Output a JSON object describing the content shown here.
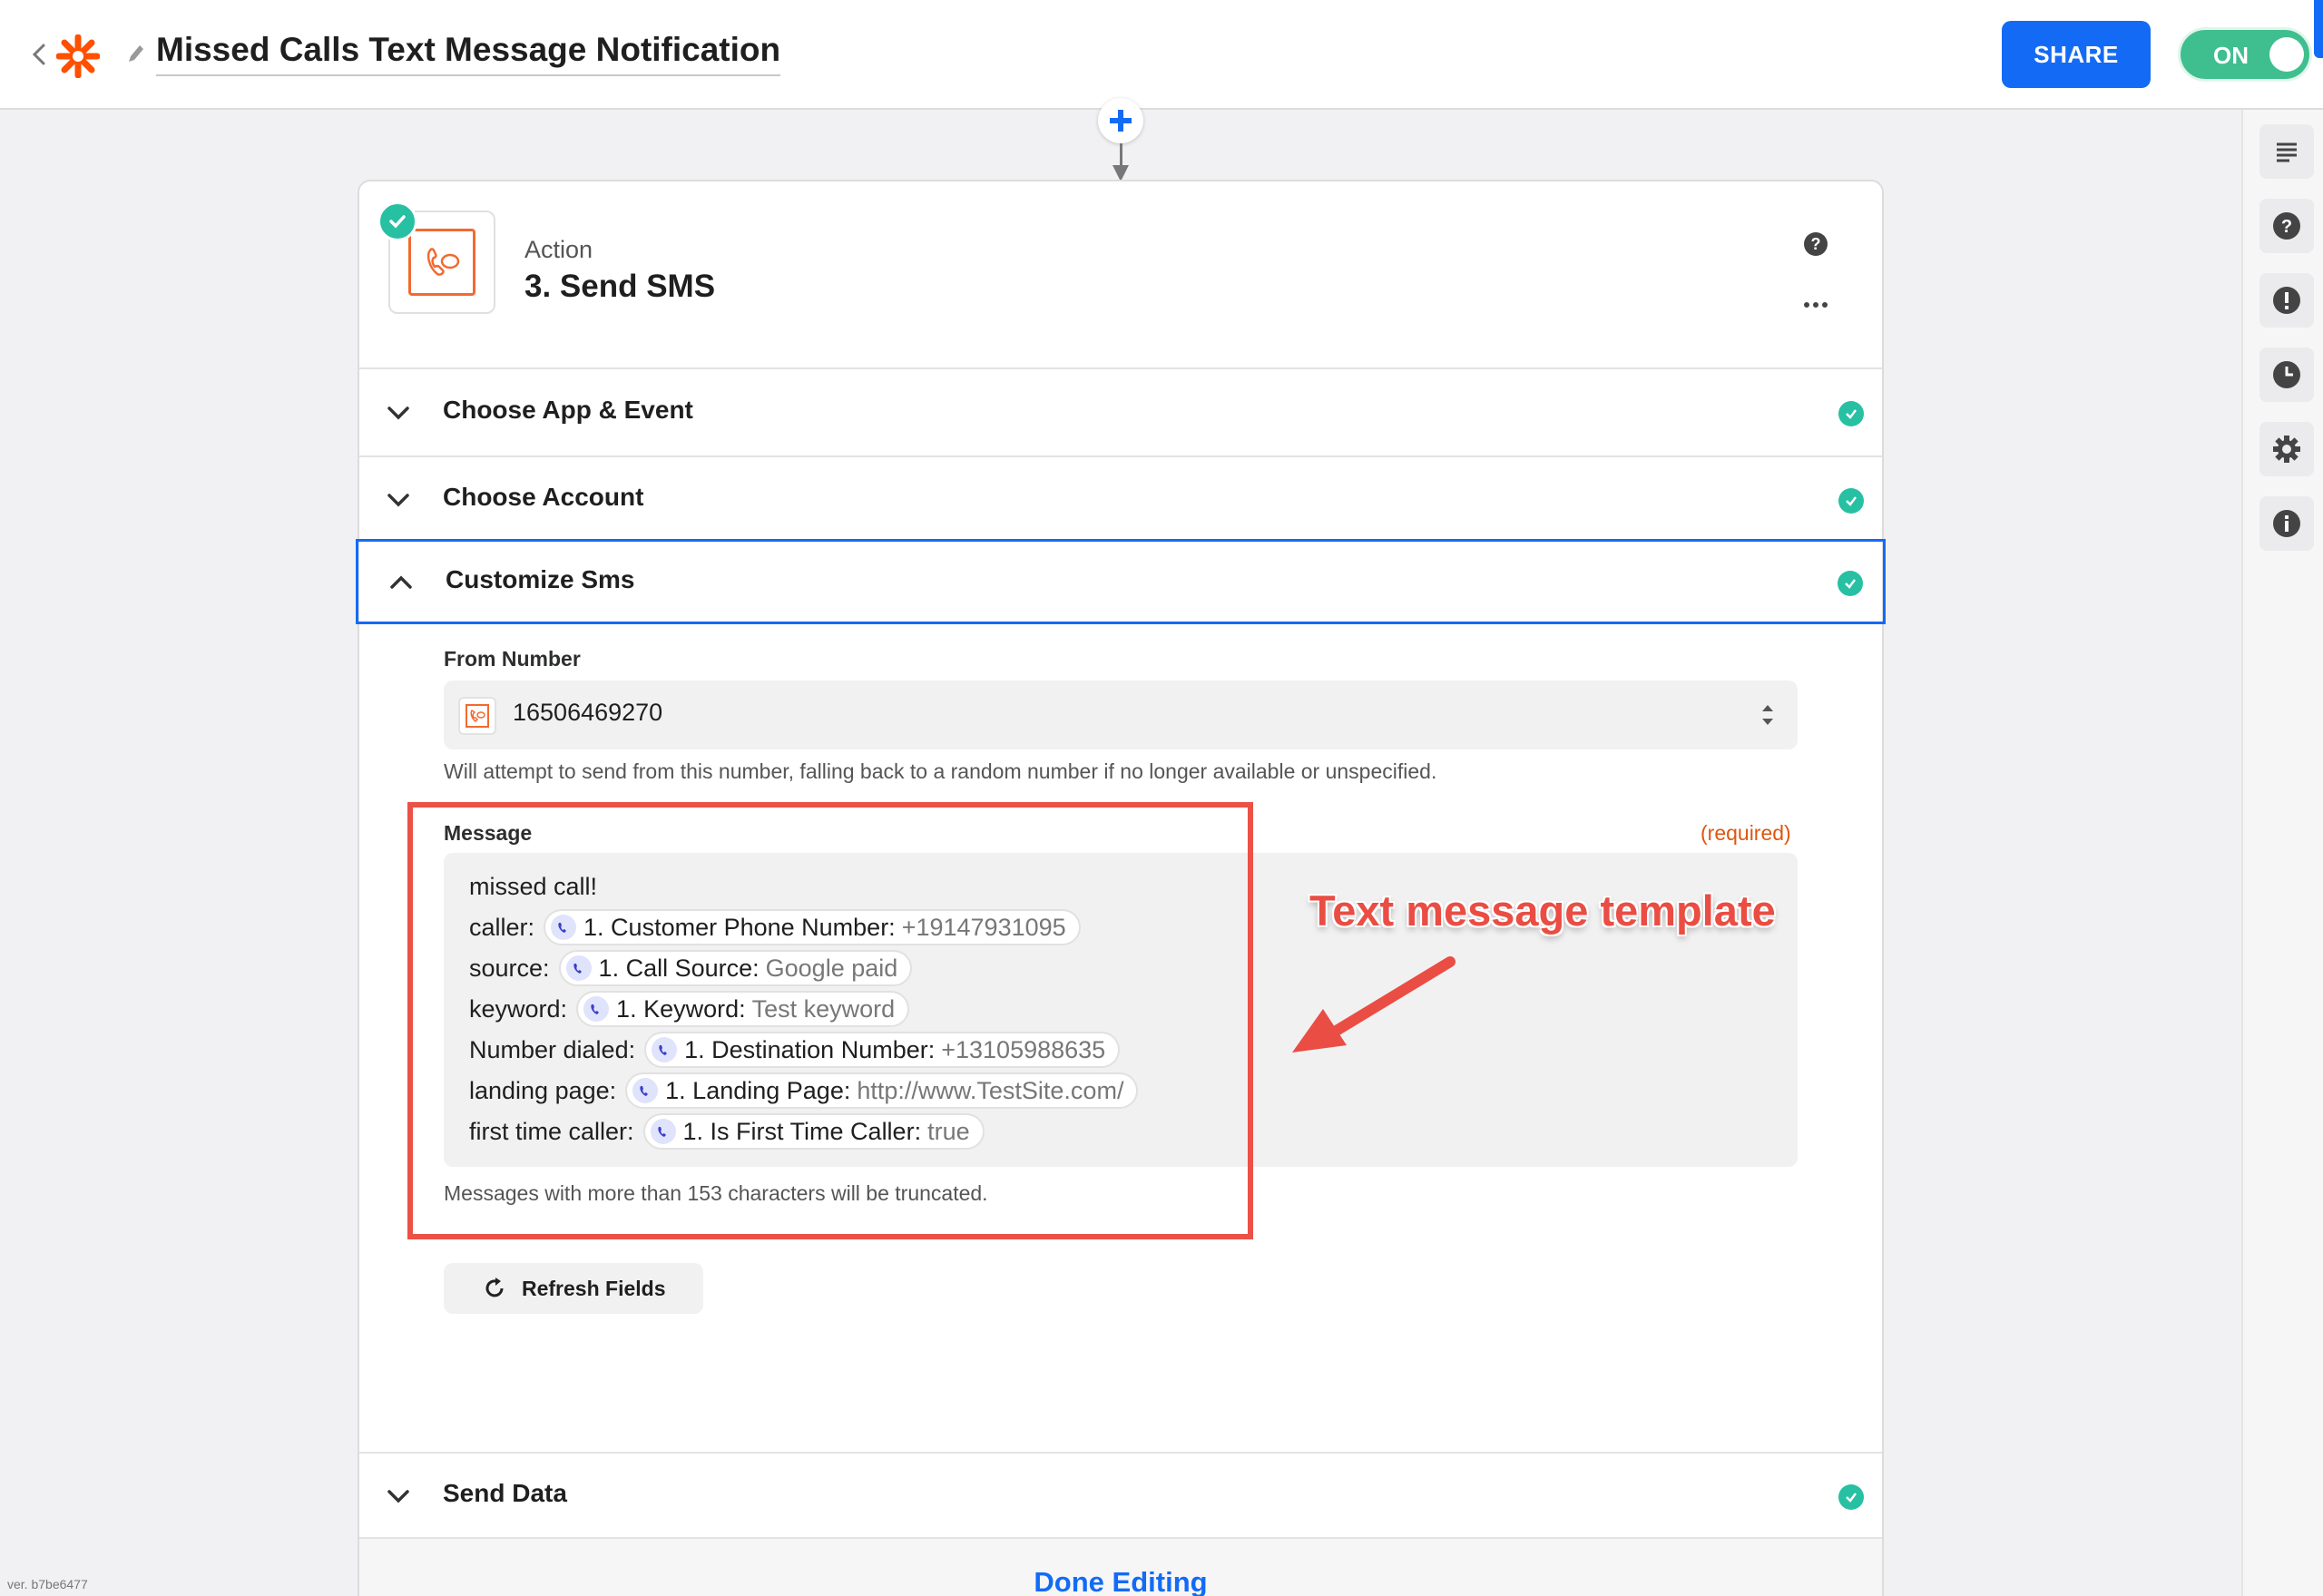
{
  "header": {
    "title": "Missed Calls Text Message Notification",
    "share_label": "SHARE",
    "toggle_label": "ON",
    "brand_color": "#ff4f00",
    "accent_color": "#136bf5"
  },
  "step": {
    "kicker": "Action",
    "title": "3. Send SMS"
  },
  "sections": {
    "choose_app": "Choose App & Event",
    "choose_account": "Choose Account",
    "customize": "Customize Sms",
    "send_data": "Send Data"
  },
  "form": {
    "from_label": "From Number",
    "from_value": "16506469270",
    "from_help": "Will attempt to send from this number, falling back to a random number if no longer available or unspecified.",
    "message_label": "Message",
    "required_label": "(required)",
    "message_lines": [
      {
        "prefix": "missed call!"
      },
      {
        "prefix": "caller:",
        "key": "1. Customer Phone Number:",
        "value": "+19147931095"
      },
      {
        "prefix": "source:",
        "key": "1. Call Source:",
        "value": "Google paid"
      },
      {
        "prefix": "keyword:",
        "key": "1. Keyword:",
        "value": "Test keyword"
      },
      {
        "prefix": "Number dialed:",
        "key": "1. Destination Number:",
        "value": "+13105988635"
      },
      {
        "prefix": "landing page:",
        "key": "1. Landing Page:",
        "value": "http://www.TestSite.com/"
      },
      {
        "prefix": "first time caller:",
        "key": "1. Is First Time Caller:",
        "value": "true"
      }
    ],
    "message_help": "Messages with more than 153 characters will be truncated.",
    "refresh_label": "Refresh Fields"
  },
  "annotation": {
    "text": "Text message template"
  },
  "footer": {
    "done_label": "Done Editing",
    "version": "ver. b7be6477"
  },
  "sidebar_icons": [
    "list-icon",
    "help-icon",
    "alert-icon",
    "history-icon",
    "settings-icon",
    "info-icon"
  ]
}
